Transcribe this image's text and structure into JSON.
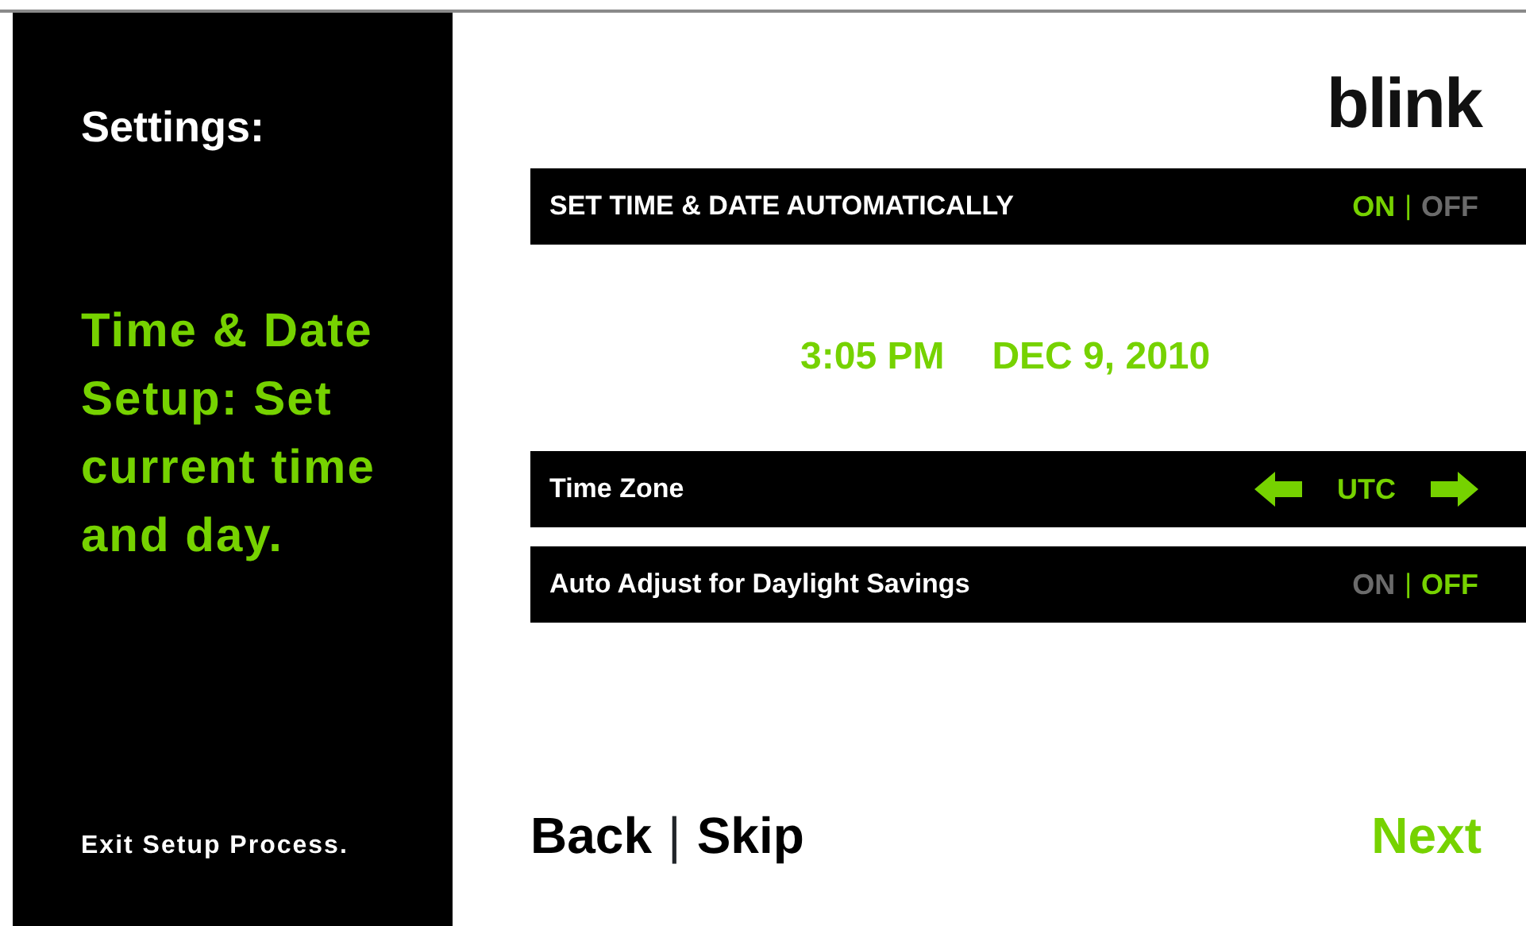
{
  "sidebar": {
    "title": "Settings:",
    "step": "Time & Date Setup: Set current time and day.",
    "exit_link": "Exit Setup Process."
  },
  "logo": "blink",
  "settings": [
    {
      "kind": "toggle",
      "label": "SET TIME & DATE AUTOMATICALLY",
      "separator": "|",
      "options": [
        {
          "label": "ON",
          "selected": true
        },
        {
          "label": "OFF",
          "selected": false
        }
      ]
    },
    {
      "kind": "clock",
      "time": "3:05 PM",
      "date": "DEC 9, 2010"
    },
    {
      "kind": "picker",
      "label": "Time Zone",
      "value": "UTC"
    },
    {
      "kind": "toggle",
      "label": "Auto Adjust for Daylight Savings",
      "separator": "|",
      "options": [
        {
          "label": "ON",
          "selected": false
        },
        {
          "label": "OFF",
          "selected": true
        }
      ]
    }
  ],
  "footer": {
    "back": "Back",
    "separator": "|",
    "skip": "Skip",
    "next": "Next"
  }
}
